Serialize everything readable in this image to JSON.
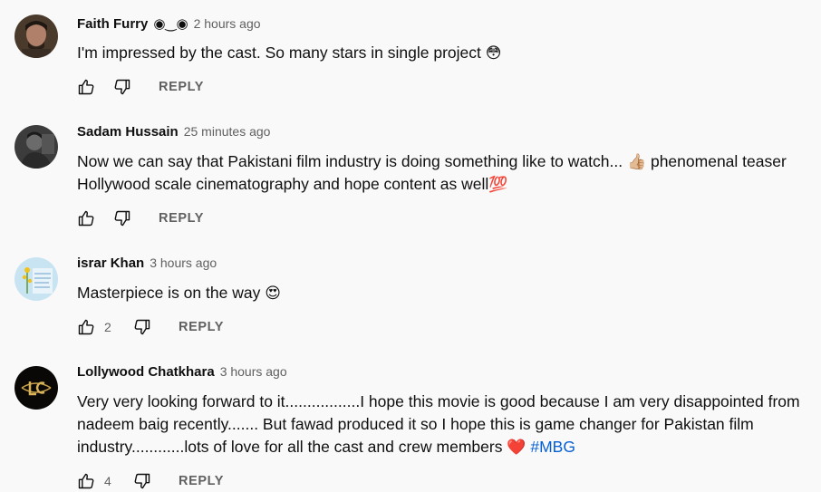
{
  "comments": [
    {
      "author": "Faith Furry",
      "author_suffix": "◉‿◉",
      "time": "2 hours ago",
      "text": "I'm impressed by the cast. So many stars in single project ",
      "emoji": "😳",
      "likes": "",
      "reply_label": "REPLY"
    },
    {
      "author": "Sadam Hussain",
      "time": "25 minutes ago",
      "text_part1": "Now we can say that Pakistani film industry is doing something like to watch... ",
      "emoji1": "👍🏼",
      "text_part2": " phenomenal teaser Hollywood scale cinematography and hope content as well",
      "emoji2": "💯",
      "likes": "",
      "reply_label": "REPLY"
    },
    {
      "author": "israr Khan",
      "time": "3 hours ago",
      "text": "Masterpiece is on the way ",
      "emoji": "😍",
      "likes": "2",
      "reply_label": "REPLY"
    },
    {
      "author": "Lollywood Chatkhara",
      "time": "3 hours ago",
      "text": "Very very looking forward to it.................I hope this movie is good because I am very disappointed from nadeem baig recently....... But fawad produced it so I hope this is game changer for Pakistan film industry............lots of love for all the cast and crew members",
      "emoji": "❤️",
      "hashtag": "#MBG",
      "likes": "4",
      "reply_label": "REPLY"
    }
  ],
  "icons": {
    "like": "thumb-up-icon",
    "dislike": "thumb-down-icon"
  },
  "colors": {
    "background": "#f9f9f9",
    "text": "#0f0f0f",
    "secondary": "#606060",
    "hashtag": "#065fd4"
  }
}
